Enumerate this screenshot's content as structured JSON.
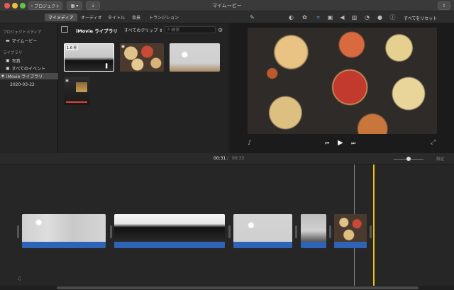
{
  "window": {
    "title": "マイムービー",
    "back_label": "プロジェクト"
  },
  "tabs": [
    {
      "label": "マイメディア",
      "active": true
    },
    {
      "label": "オーディオ",
      "active": false
    },
    {
      "label": "タイトル",
      "active": false
    },
    {
      "label": "背景",
      "active": false
    },
    {
      "label": "トランジション",
      "active": false
    }
  ],
  "toolbar": {
    "reset_label": "すべてをリセット"
  },
  "sidebar": {
    "section1": "プロジェクトメディア",
    "my_movie": "マイムービー",
    "section2": "ライブラリ",
    "photos": "写真",
    "all_events": "すべてのイベント",
    "library": "iMovie ライブラリ",
    "event_date": "2020-03-22"
  },
  "browser": {
    "library_title": "iMovie ライブラリ",
    "filter": "すべてのクリップ",
    "search_placeholder": "検索",
    "thumb_duration": "1.6 秒"
  },
  "playback": {
    "current_time": "00:31",
    "separator": "/",
    "total_time": "00:33",
    "settings_label": "設定"
  }
}
